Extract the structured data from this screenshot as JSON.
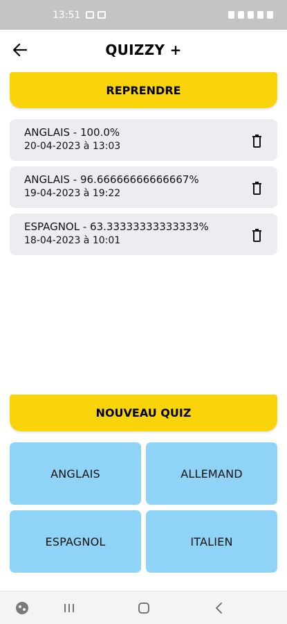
{
  "status_bar": {
    "time": "13:51",
    "left_icons": [
      "image-icon",
      "notification-box-icon"
    ],
    "right_icons": [
      "alarm-icon",
      "vibrate-icon",
      "wifi-icon",
      "signal-icon",
      "battery-icon"
    ]
  },
  "header": {
    "title": "QUIZZY +",
    "back_icon": "arrow-left-icon"
  },
  "resume_button": {
    "label": "REPRENDRE"
  },
  "history": [
    {
      "title": "ANGLAIS - 100.0%",
      "date": "20-04-2023 à 13:03",
      "delete_icon": "trash-icon"
    },
    {
      "title": "ANGLAIS - 96.66666666666667%",
      "date": "19-04-2023 à 19:22",
      "delete_icon": "trash-icon"
    },
    {
      "title": "ESPAGNOL - 63.33333333333333%",
      "date": "18-04-2023 à 10:01",
      "delete_icon": "trash-icon"
    }
  ],
  "new_quiz_button": {
    "label": "NOUVEAU QUIZ"
  },
  "languages": [
    {
      "label": "ANGLAIS"
    },
    {
      "label": "ALLEMAND"
    },
    {
      "label": "ESPAGNOL"
    },
    {
      "label": "ITALIEN"
    }
  ],
  "nav_bar": {
    "items": [
      "assistant-icon",
      "recent-apps-icon",
      "home-icon",
      "back-icon"
    ]
  },
  "colors": {
    "accent_yellow": "#f9d40a",
    "tile_blue": "#8fd4f7",
    "card_grey": "#ededf1",
    "status_bar_grey": "#c4c4c4"
  }
}
